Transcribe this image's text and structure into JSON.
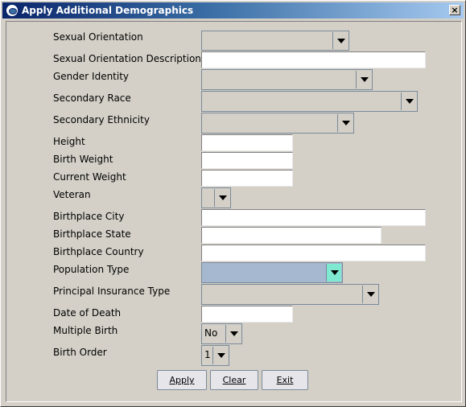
{
  "window": {
    "title": "Apply Additional Demographics",
    "close_label": "×"
  },
  "fields": {
    "sexual_orientation": {
      "label": "Sexual Orientation",
      "value": ""
    },
    "sexual_orientation_description": {
      "label": "Sexual Orientation Description",
      "value": ""
    },
    "gender_identity": {
      "label": "Gender Identity",
      "value": ""
    },
    "secondary_race": {
      "label": "Secondary Race",
      "value": ""
    },
    "secondary_ethnicity": {
      "label": "Secondary Ethnicity",
      "value": ""
    },
    "height": {
      "label": "Height",
      "value": ""
    },
    "birth_weight": {
      "label": "Birth Weight",
      "value": ""
    },
    "current_weight": {
      "label": "Current Weight",
      "value": ""
    },
    "veteran": {
      "label": "Veteran",
      "value": ""
    },
    "birthplace_city": {
      "label": "Birthplace City",
      "value": ""
    },
    "birthplace_state": {
      "label": "Birthplace State",
      "value": ""
    },
    "birthplace_country": {
      "label": "Birthplace Country",
      "value": ""
    },
    "population_type": {
      "label": "Population Type",
      "value": ""
    },
    "principal_insurance_type": {
      "label": "Principal Insurance Type",
      "value": ""
    },
    "date_of_death": {
      "label": "Date of Death",
      "value": ""
    },
    "multiple_birth": {
      "label": "Multiple Birth",
      "value": "No"
    },
    "birth_order": {
      "label": "Birth Order",
      "value": "1"
    }
  },
  "buttons": {
    "apply": "Apply",
    "clear": "Clear",
    "exit": "Exit"
  },
  "icons": {
    "title": "app-icon",
    "dropdown": "chevron-down-icon"
  }
}
